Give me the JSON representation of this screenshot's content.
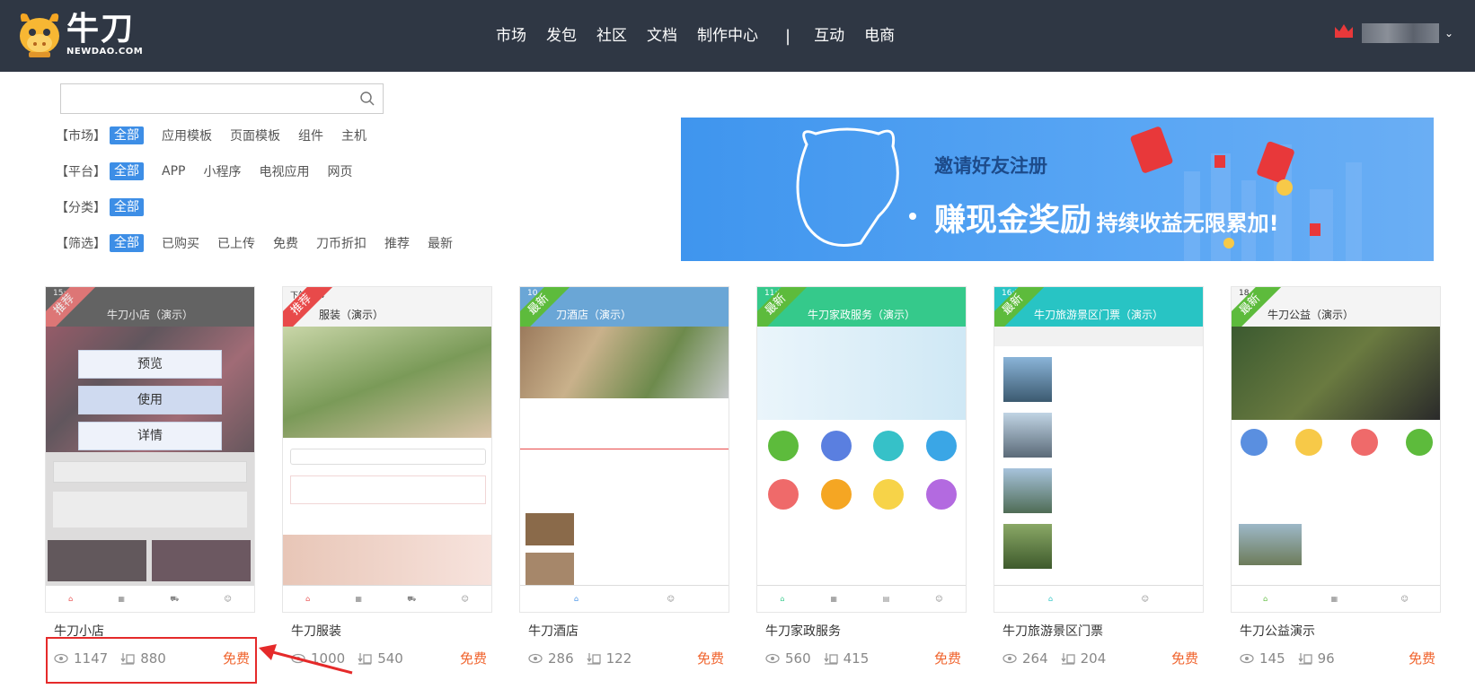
{
  "header": {
    "logo_cn": "牛刀",
    "logo_en": "NEWDAO.COM",
    "nav": [
      "市场",
      "发包",
      "社区",
      "文档",
      "制作中心"
    ],
    "nav_separator": "|",
    "nav_right": [
      "互动",
      "电商"
    ],
    "user_caret": "⌄"
  },
  "search": {
    "placeholder": "",
    "value": ""
  },
  "filters": [
    {
      "key": "【市场】",
      "options": [
        "全部",
        "应用模板",
        "页面模板",
        "组件",
        "主机"
      ]
    },
    {
      "key": "【平台】",
      "options": [
        "全部",
        "APP",
        "小程序",
        "电视应用",
        "网页"
      ]
    },
    {
      "key": "【分类】",
      "options": [
        "全部"
      ]
    },
    {
      "key": "【筛选】",
      "options": [
        "全部",
        "已购买",
        "已上传",
        "免费",
        "刀币折扣",
        "推荐",
        "最新"
      ]
    }
  ],
  "banner": {
    "line1": "邀请好友注册",
    "line2_big": "赚现金奖励",
    "line2_small": "持续收益无限累加!"
  },
  "cards": [
    {
      "name": "牛刀小店",
      "views": "1147",
      "downloads": "880",
      "price": "免费",
      "ribbon": "推荐",
      "ribbon_color": "red",
      "shot_title": "牛刀小店（演示）",
      "shot_color": "#2d2d2d",
      "time": "15:49",
      "overlay": [
        "预览",
        "使用",
        "详情"
      ]
    },
    {
      "name": "牛刀服装",
      "views": "1000",
      "downloads": "540",
      "price": "免费",
      "ribbon": "推荐",
      "ribbon_color": "red",
      "shot_title": "服装（演示）",
      "shot_color": "#f4f4f4",
      "time": "下午5:14"
    },
    {
      "name": "牛刀酒店",
      "views": "286",
      "downloads": "122",
      "price": "免费",
      "ribbon": "最新",
      "ribbon_color": "green",
      "shot_title": "刀酒店（演示）",
      "shot_color": "#6aa6d6",
      "time": "10"
    },
    {
      "name": "牛刀家政服务",
      "views": "560",
      "downloads": "415",
      "price": "免费",
      "ribbon": "最新",
      "ribbon_color": "green",
      "shot_title": "牛刀家政服务（演示）",
      "shot_color": "#35c98b",
      "time": "11:25"
    },
    {
      "name": "牛刀旅游景区门票",
      "views": "264",
      "downloads": "204",
      "price": "免费",
      "ribbon": "最新",
      "ribbon_color": "green",
      "shot_title": "牛刀旅游景区门票（演示）",
      "shot_color": "#28c4c4",
      "time": "16:54"
    },
    {
      "name": "牛刀公益演示",
      "views": "145",
      "downloads": "96",
      "price": "免费",
      "ribbon": "最新",
      "ribbon_color": "green",
      "shot_title": "牛刀公益（演示）",
      "shot_color": "#f4f4f4",
      "time": "18"
    }
  ],
  "colors": {
    "topbar": "#2f3744",
    "accent": "#3d8ee6",
    "price": "#f0642e",
    "highlight": "#e52a2a"
  }
}
